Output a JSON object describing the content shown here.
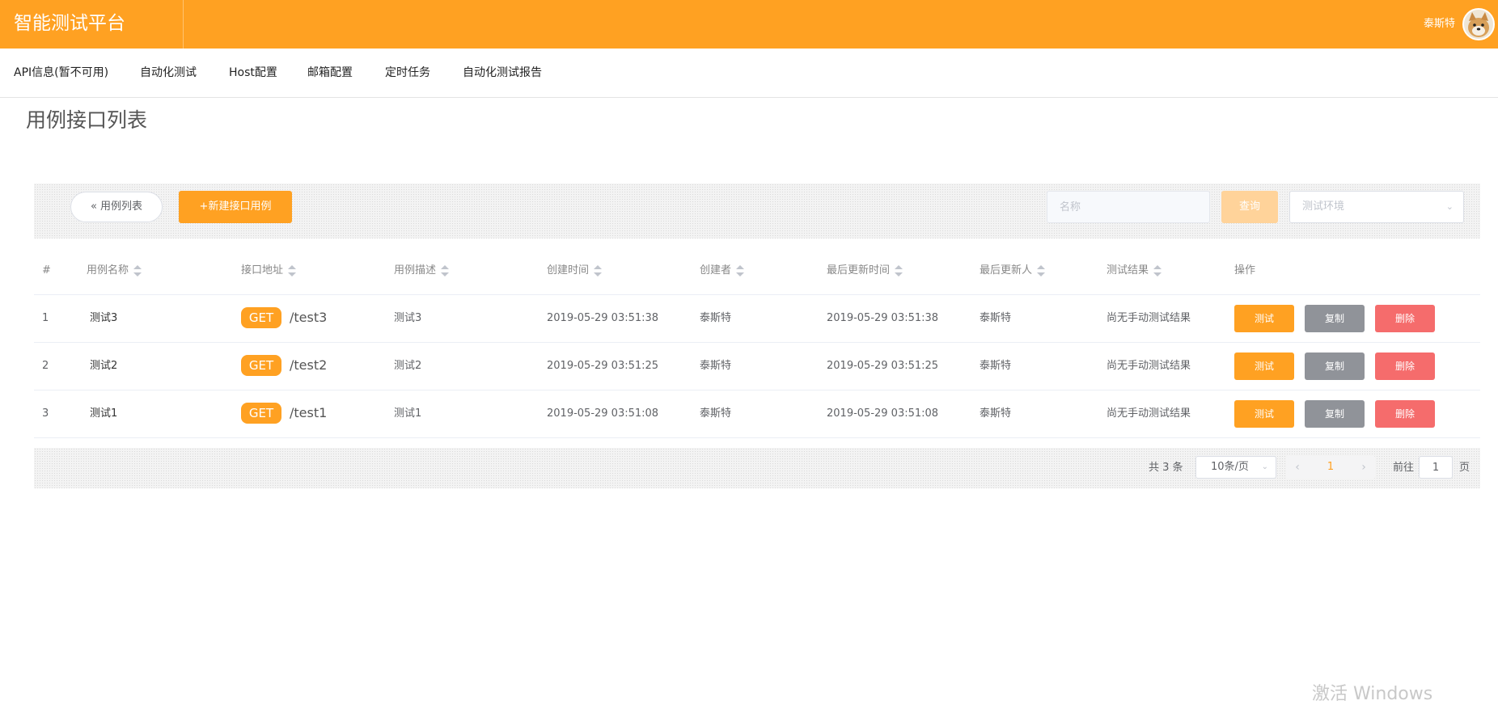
{
  "app": {
    "title": "智能测试平台",
    "username": "泰斯特"
  },
  "nav": {
    "items": [
      {
        "label": "API信息(暂不可用)"
      },
      {
        "label": "自动化测试"
      },
      {
        "label": "Host配置"
      },
      {
        "label": "邮箱配置"
      },
      {
        "label": "定时任务"
      },
      {
        "label": "自动化测试报告"
      }
    ]
  },
  "page": {
    "title": "用例接口列表"
  },
  "toolbar": {
    "back_label": "« 用例列表",
    "new_label": "+新建接口用例",
    "search_placeholder": "名称",
    "query_label": "查询",
    "env_placeholder": "测试环境"
  },
  "table": {
    "headers": [
      "#",
      "用例名称",
      "接口地址",
      "用例描述",
      "创建时间",
      "创建者",
      "最后更新时间",
      "最后更新人",
      "测试结果",
      "操作"
    ],
    "rows": [
      {
        "index": "1",
        "name": "测试3",
        "method": "GET",
        "path": "/test3",
        "desc": "测试3",
        "created": "2019-05-29 03:51:38",
        "creator": "泰斯特",
        "updated": "2019-05-29 03:51:38",
        "updater": "泰斯特",
        "result": "尚无手动测试结果"
      },
      {
        "index": "2",
        "name": "测试2",
        "method": "GET",
        "path": "/test2",
        "desc": "测试2",
        "created": "2019-05-29 03:51:25",
        "creator": "泰斯特",
        "updated": "2019-05-29 03:51:25",
        "updater": "泰斯特",
        "result": "尚无手动测试结果"
      },
      {
        "index": "3",
        "name": "测试1",
        "method": "GET",
        "path": "/test1",
        "desc": "测试1",
        "created": "2019-05-29 03:51:08",
        "creator": "泰斯特",
        "updated": "2019-05-29 03:51:08",
        "updater": "泰斯特",
        "result": "尚无手动测试结果"
      }
    ],
    "actions": {
      "test": "测试",
      "copy": "复制",
      "delete": "删除"
    }
  },
  "pagination": {
    "total": "共 3 条",
    "page_size": "10条/页",
    "current_page": "1",
    "goto_label": "前往",
    "goto_value": "1",
    "page_suffix": "页"
  },
  "watermark": "激活 Windows",
  "colors": {
    "accent": "#ffa122",
    "copy": "#909399",
    "delete": "#f56c6c"
  }
}
